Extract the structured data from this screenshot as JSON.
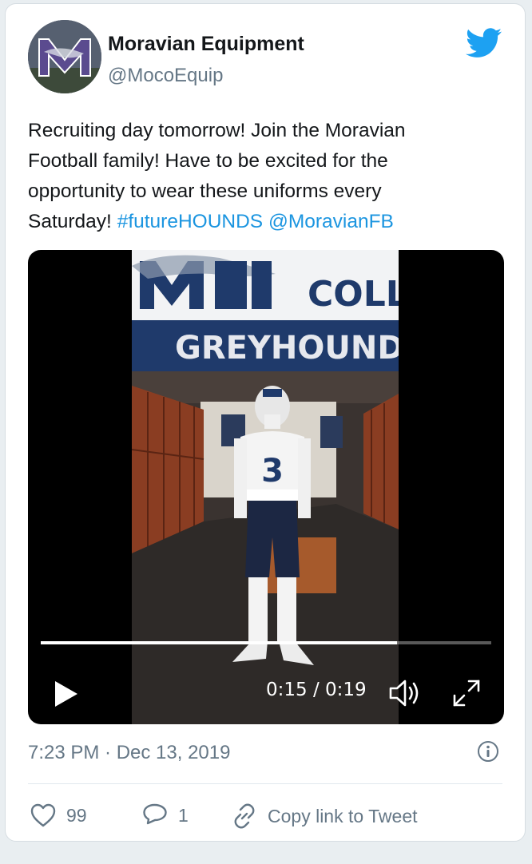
{
  "tweet": {
    "display_name": "Moravian Equipment",
    "handle": "@MocoEquip",
    "text_lines": [
      "Recruiting day tomorrow! Join the Moravian",
      "Football family! Have to be excited for the",
      "opportunity to wear these uniforms every"
    ],
    "last_line_prefix": "Saturday! ",
    "hashtag": "#futureHOUNDS",
    "mention": "@MoravianFB",
    "timestamp": "7:23 PM · Dec 13, 2019"
  },
  "video": {
    "banner_top": "COLL",
    "banner_main": "GREYHOUNDS",
    "jersey_number": "3",
    "time_label": "0:15 / 0:19",
    "progress": 0.79
  },
  "actions": {
    "likes": "99",
    "replies": "1",
    "copy_link_label": "Copy link to Tweet"
  },
  "icons": {
    "bird": "twitter-bird-icon",
    "play": "play-icon",
    "volume": "volume-icon",
    "fullscreen": "fullscreen-icon",
    "info": "info-icon",
    "heart": "heart-icon",
    "reply": "reply-icon",
    "link": "link-icon"
  },
  "colors": {
    "accent": "#1b95e0",
    "secondary_text": "#657786",
    "text": "#14171a",
    "brand_navy": "#1f3a6b"
  }
}
